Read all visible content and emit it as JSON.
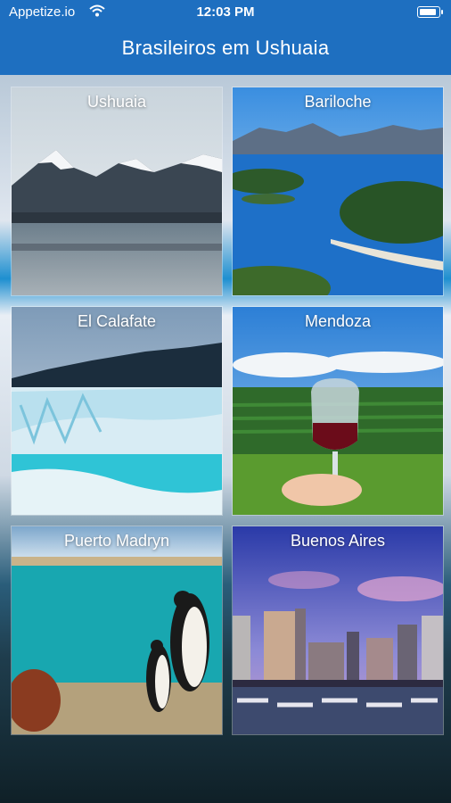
{
  "status_bar": {
    "carrier": "Appetize.io",
    "time": "12:03 PM"
  },
  "nav": {
    "title": "Brasileiros em Ushuaia"
  },
  "destinations": [
    {
      "label": "Ushuaia"
    },
    {
      "label": "Bariloche"
    },
    {
      "label": "El Calafate"
    },
    {
      "label": "Mendoza"
    },
    {
      "label": "Puerto Madryn"
    },
    {
      "label": "Buenos Aires"
    }
  ],
  "colors": {
    "accent": "#1e6fc0"
  },
  "icons": {
    "wifi": "wifi-icon",
    "battery": "battery-icon"
  }
}
